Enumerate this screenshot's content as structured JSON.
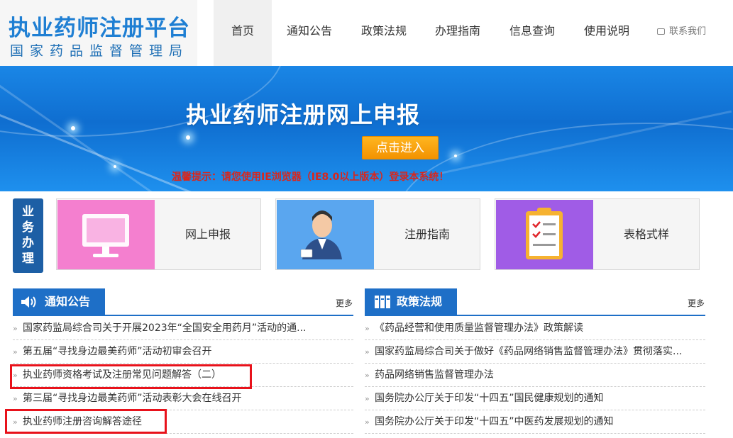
{
  "header": {
    "title": "执业药师注册平台",
    "subtitle": "国家药品监督管理局",
    "nav": [
      {
        "label": "首页",
        "active": true
      },
      {
        "label": "通知公告"
      },
      {
        "label": "政策法规"
      },
      {
        "label": "办理指南"
      },
      {
        "label": "信息查询"
      },
      {
        "label": "使用说明"
      }
    ],
    "contact": "联系我们"
  },
  "banner": {
    "title": "执业药师注册网上申报",
    "button": "点击进入",
    "warning": "温馨提示：请您使用IE浏览器（IE8.0以上版本）登录本系统！"
  },
  "business": {
    "tag": [
      "业",
      "务",
      "办",
      "理"
    ],
    "cards": [
      {
        "label": "网上申报",
        "icon": "monitor-icon",
        "color": "#f47fcf"
      },
      {
        "label": "注册指南",
        "icon": "person-badge-icon",
        "color": "#5aa6ef"
      },
      {
        "label": "表格式样",
        "icon": "clipboard-icon",
        "color": "#a05ce6"
      }
    ]
  },
  "notices": {
    "title": "通知公告",
    "more": "更多",
    "items": [
      "国家药监局综合司关于开展2023年“全国安全用药月”活动的通...",
      "第五届“寻找身边最美药师”活动初审会召开",
      "执业药师资格考试及注册常见问题解答（二）",
      "第三届“寻找身边最美药师”活动表彰大会在线召开",
      "执业药师注册咨询解答途径"
    ]
  },
  "policies": {
    "title": "政策法规",
    "more": "更多",
    "items": [
      "《药品经营和使用质量监督管理办法》政策解读",
      "国家药监局综合司关于做好《药品网络销售监督管理办法》贯彻落实...",
      "药品网络销售监督管理办法",
      "国务院办公厅关于印发“十四五”国民健康规划的通知",
      "国务院办公厅关于印发“十四五”中医药发展规划的通知"
    ]
  },
  "colors": {
    "brand": "#1f7fd3",
    "section": "#1e6fc7",
    "warning": "#d9261c",
    "highlight": "#e8121b"
  }
}
